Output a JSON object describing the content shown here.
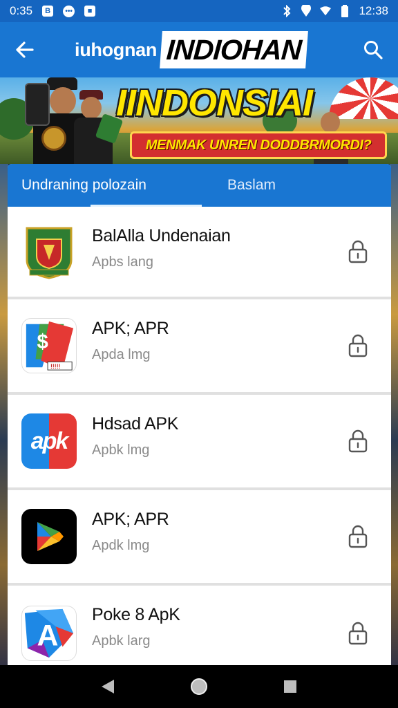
{
  "status_bar": {
    "time_left": "0:35",
    "time_right": "12:38",
    "left_icons": [
      "b-notification-icon",
      "chat-bubble-icon",
      "square-notification-icon"
    ],
    "right_icons": [
      "bluetooth-icon",
      "location-icon",
      "wifi-icon",
      "battery-icon"
    ]
  },
  "app_bar": {
    "title": "iuhognan",
    "title_badge": "INDIOHAN"
  },
  "banner": {
    "headline": "IINDONSIAI",
    "ribbon_text": "MENMAK UNREN DODDBRMORDI?"
  },
  "tabs": [
    {
      "label": "Undraning polozain",
      "active": true
    },
    {
      "label": "Baslam",
      "active": false
    }
  ],
  "apps": [
    {
      "title": "BalAlla Undenaian",
      "subtitle": "Apbs lang",
      "icon": "emblem-icon"
    },
    {
      "title": "APK; APR",
      "subtitle": "Apda lmg",
      "icon": "dollar-card-icon"
    },
    {
      "title": "Hdsad APK",
      "subtitle": "Apbk lmg",
      "icon": "apk-logo-icon"
    },
    {
      "title": "APK; APR",
      "subtitle": "Apdk lmg",
      "icon": "play-store-icon"
    },
    {
      "title": "Poke 8 ApK",
      "subtitle": "Apbk larg",
      "icon": "a-letter-icon"
    }
  ],
  "icon_glyphs": {
    "apk_logo_text": "apk",
    "dollar_sign": "$",
    "card_label": "A"
  },
  "colors": {
    "primary": "#1976d2",
    "status_bar": "#1565c0",
    "banner_headline": "#ffe600",
    "ribbon": "#d32f2f"
  }
}
